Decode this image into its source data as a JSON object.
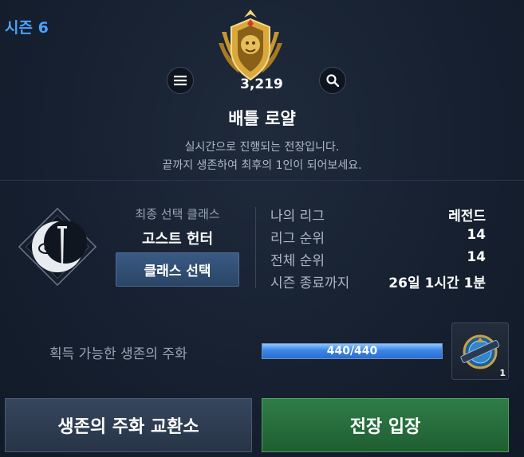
{
  "season": {
    "label": "시즌 6"
  },
  "header": {
    "rating": "3,219",
    "mode_title": "배틀 로얄",
    "description_line1": "실시간으로 진행되는 전장입니다.",
    "description_line2": "끝까지 생존하여 최후의 1인이 되어보세요.",
    "menu_icon": "menu-icon",
    "search_icon": "search-icon",
    "rank_emblem_icon": "legend-rank-emblem"
  },
  "class_panel": {
    "caption": "최종 선택 클래스",
    "name": "고스트 헌터",
    "select_button": "클래스 선택",
    "icon": "ghost-hunter-class-icon"
  },
  "stats": [
    {
      "label": "나의 리그",
      "value": "레전드"
    },
    {
      "label": "리그 순위",
      "value": "14"
    },
    {
      "label": "전체 순위",
      "value": "14"
    },
    {
      "label": "시즌 종료까지",
      "value": "26일 1시간 1분"
    }
  ],
  "coin": {
    "label": "획득 가능한 생존의 주화",
    "progress_text": "440/440",
    "progress_fraction": 1.0,
    "item_icon": "survival-coin-icon",
    "item_count": "1"
  },
  "buttons": {
    "exchange": "생존의 주화 교환소",
    "enter": "전장 입장"
  },
  "colors": {
    "season_accent": "#4aa3ff",
    "enter_button": "#2f7d47",
    "exchange_button": "#36465e",
    "progress_fill": "#3a85e6"
  }
}
